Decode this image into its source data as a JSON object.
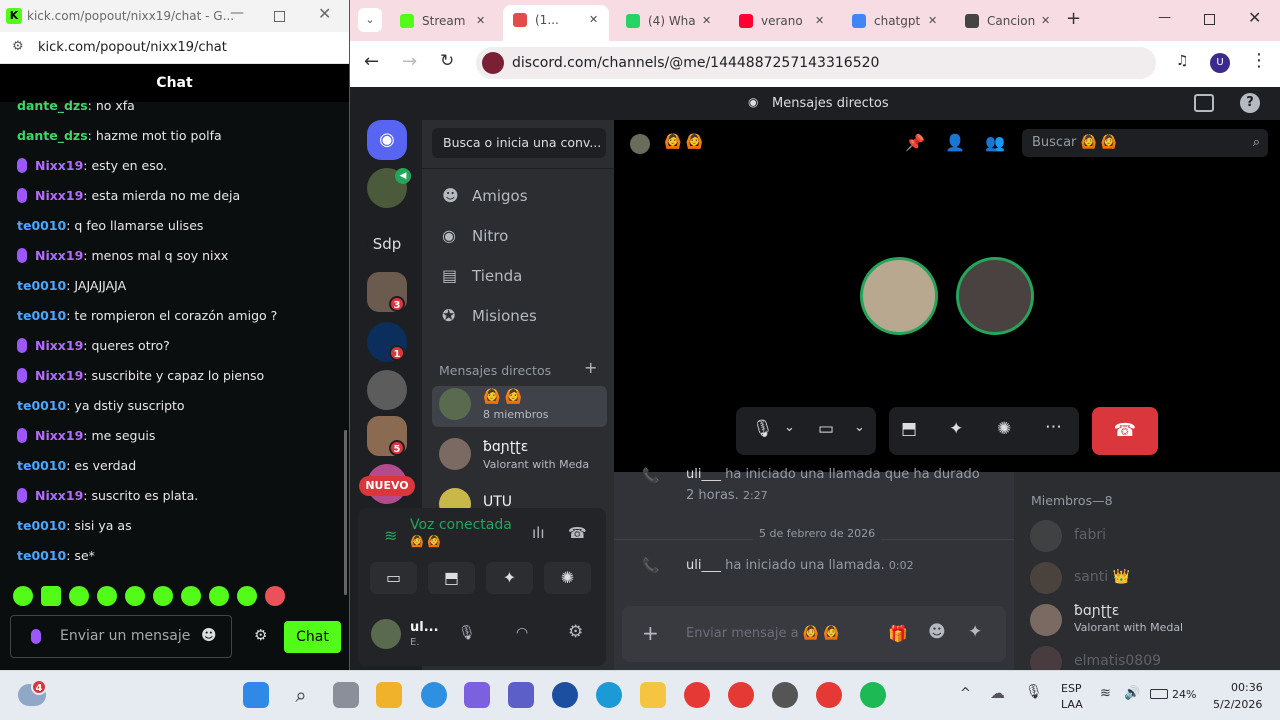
{
  "kick": {
    "window_title": "kick.com/popout/nixx19/chat - G...",
    "url": "kick.com/popout/nixx19/chat",
    "header": "Chat",
    "messages": [
      {
        "user": "dante_dzs",
        "text": ": no xfa",
        "type": "dante"
      },
      {
        "user": "dante_dzs",
        "text": ": hazme mot tio polfa",
        "type": "dante"
      },
      {
        "user": "Nixx19",
        "text": ": esty en eso.",
        "type": "nixx"
      },
      {
        "user": "Nixx19",
        "text": ": esta mierda no me deja",
        "type": "nixx"
      },
      {
        "user": "te0010",
        "text": ": q feo llamarse ulises",
        "type": "te"
      },
      {
        "user": "Nixx19",
        "text": ": menos mal q soy nixx",
        "type": "nixx"
      },
      {
        "user": "te0010",
        "text": ": JAJAJJAJA",
        "type": "te"
      },
      {
        "user": "te0010",
        "text": ": te rompieron el corazón amigo ?",
        "type": "te"
      },
      {
        "user": "Nixx19",
        "text": ": queres otro?",
        "type": "nixx"
      },
      {
        "user": "Nixx19",
        "text": ": suscribite y capaz lo pienso",
        "type": "nixx"
      },
      {
        "user": "te0010",
        "text": ": ya dstiy suscripto",
        "type": "te"
      },
      {
        "user": "Nixx19",
        "text": ": me seguis",
        "type": "nixx"
      },
      {
        "user": "te0010",
        "text": ": es verdad",
        "type": "te"
      },
      {
        "user": "Nixx19",
        "text": ": suscrito es plata.",
        "type": "nixx"
      },
      {
        "user": "te0010",
        "text": ": sisi ya as",
        "type": "te"
      },
      {
        "user": "te0010",
        "text": ": se*",
        "type": "te"
      }
    ],
    "input_placeholder": "Enviar un mensaje",
    "chat_button": "Chat"
  },
  "browser": {
    "tabs": [
      {
        "label": "Stream",
        "icon": "kick-icon",
        "color": "#53fc18"
      },
      {
        "label": "(1...",
        "icon": "discord-icon",
        "color": "#e34c4c",
        "active": true
      },
      {
        "label": "(4) Wha",
        "icon": "whatsapp-icon",
        "color": "#25d366"
      },
      {
        "label": "verano",
        "icon": "youtube-icon",
        "color": "#ff0033"
      },
      {
        "label": "chatgpt",
        "icon": "google-icon",
        "color": "#4285f4"
      },
      {
        "label": "Cancion",
        "icon": "chatgpt-icon",
        "color": "#444444"
      }
    ],
    "url": "discord.com/channels/@me/1444887257143316520",
    "profile_letter": "U"
  },
  "discord": {
    "top_title": "Mensajes directos",
    "search_conv": "Busca o inicia una conv...",
    "server_text": "Sdp",
    "new_badge": "NUEVO",
    "server_badges": [
      "3",
      "1",
      "5"
    ],
    "nav": [
      {
        "label": "Amigos",
        "icon": "friends-icon"
      },
      {
        "label": "Nitro",
        "icon": "nitro-icon"
      },
      {
        "label": "Tienda",
        "icon": "shop-icon"
      },
      {
        "label": "Misiones",
        "icon": "quests-icon"
      }
    ],
    "dm_header": "Mensajes directos",
    "dms": [
      {
        "name": "🙆 🙆",
        "sub": "8 miembros"
      },
      {
        "name": "ƀɑɲʈʈɛ",
        "sub": "Valorant with Meda"
      },
      {
        "name": "UTU",
        "sub": ""
      }
    ],
    "voice": {
      "status": "Voz conectada",
      "channel": "🙆 🙆"
    },
    "user": {
      "name": "ul...",
      "sub": "E."
    },
    "call_header": "🙆 🙆",
    "search_placeholder": "Buscar 🙆 🙆",
    "messages": [
      {
        "user": "uli___",
        "text": "ha iniciado una llamada que ha durado 2 horas.",
        "time": "2:27"
      },
      {
        "user": "uli___",
        "text": "ha iniciado una llamada.",
        "time": "0:02"
      }
    ],
    "date_divider": "5 de febrero de 2026",
    "message_placeholder": "Enviar mensaje a 🙆 🙆",
    "members_header": "Miembros—8",
    "members": [
      {
        "name": "fabri",
        "sub": ""
      },
      {
        "name": "santi 👑",
        "sub": ""
      },
      {
        "name": "ƀɑɲʈʈɛ",
        "sub": "Valorant with Medal"
      },
      {
        "name": "elmatis0809",
        "sub": ""
      }
    ]
  },
  "taskbar": {
    "weather_badge": "4",
    "language": "ESP",
    "layout": "LAA",
    "battery": "24%",
    "time": "00:36",
    "date": "5/2/2026"
  }
}
